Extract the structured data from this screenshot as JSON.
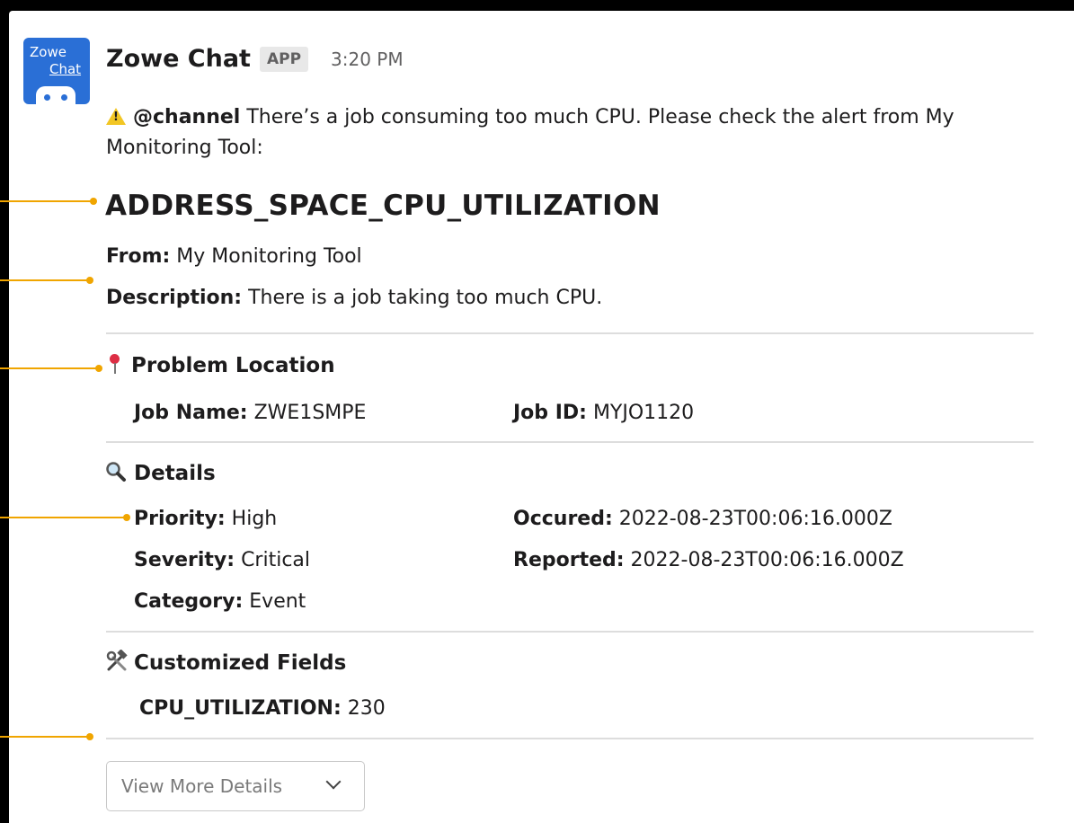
{
  "app": {
    "avatar_line1": "Zowe",
    "avatar_line2": "Chat",
    "sender": "Zowe Chat",
    "badge": "APP",
    "timestamp": "3:20 PM"
  },
  "message": {
    "mention": "@channel",
    "text": " There’s a job consuming too much CPU. Please check the alert from My Monitoring Tool:"
  },
  "alert": {
    "title": "ADDRESS_SPACE_CPU_UTILIZATION",
    "from_label": "From:",
    "from_value": " My Monitoring Tool",
    "description_label": "Description:",
    "description_value": " There is a job taking too much CPU."
  },
  "problem_location": {
    "title": "Problem Location",
    "job_name_label": "Job Name:",
    "job_name_value": " ZWE1SMPE",
    "job_id_label": "Job ID:",
    "job_id_value": " MYJO1120"
  },
  "details": {
    "title": "Details",
    "priority_label": "Priority:",
    "priority_value": " High",
    "severity_label": "Severity:",
    "severity_value": " Critical",
    "category_label": "Category:",
    "category_value": " Event",
    "occured_label": "Occured:",
    "occured_value": " 2022-08-23T00:06:16.000Z",
    "reported_label": "Reported:",
    "reported_value": " 2022-08-23T00:06:16.000Z"
  },
  "customized_fields": {
    "title": "Customized Fields",
    "cpu_label": "CPU_UTILIZATION:",
    "cpu_value": " 230"
  },
  "dropdown": {
    "label": "View More Details"
  },
  "icons": {
    "warning": "warning-icon",
    "pin": "round-pushpin-icon",
    "magnifier": "magnifying-glass-icon",
    "tools": "hammer-wrench-icon",
    "chevron": "chevron-down-icon"
  },
  "colors": {
    "background": "#000000",
    "card": "#ffffff",
    "avatar": "#2a6fd6",
    "annotation": "#f0a500",
    "divider": "#dddddd"
  }
}
